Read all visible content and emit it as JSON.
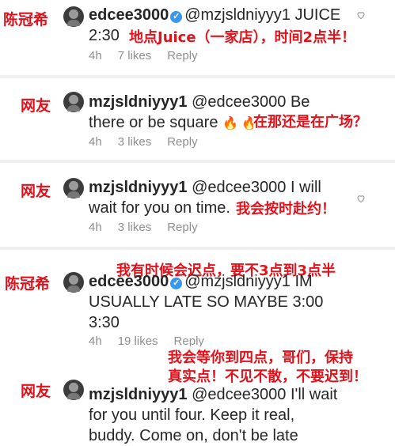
{
  "comments": [
    {
      "tag": "陈冠希",
      "username": "edcee3000",
      "verified": true,
      "mention": "@mzjsldniyyy1",
      "text_lines": [
        "JUICE",
        "2:30"
      ],
      "time": "4h",
      "likes": "7 likes",
      "reply": "Reply",
      "annotation": "地点Juice（一家店），时间2点半！"
    },
    {
      "tag": "网友",
      "username": "mzjsldniyyy1",
      "mention": "@edcee3000",
      "text_lines": [
        "Be",
        "there or be square"
      ],
      "emoji": "🔥 🔥",
      "time": "4h",
      "likes": "3 likes",
      "reply": "Reply",
      "annotation": "在那还是在广场？"
    },
    {
      "tag": "网友",
      "username": "mzjsldniyyy1",
      "mention": "@edcee3000",
      "text_lines": [
        "I will",
        "wait for you on time."
      ],
      "time": "4h",
      "likes": "3 likes",
      "reply": "Reply",
      "annotation": "我会按时赴约！"
    },
    {
      "tag": "陈冠希",
      "username": "edcee3000",
      "verified": true,
      "mention": "@mzjsldniyyy1",
      "text_lines": [
        "IM",
        "USUALLY LATE SO MAYBE 3:00",
        "3:30"
      ],
      "time": "4h",
      "likes": "19 likes",
      "reply": "Reply",
      "annotation": "我有时候会迟点，要不3点到3点半"
    },
    {
      "tag": "网友",
      "username": "mzjsldniyyy1",
      "mention": "@edcee3000",
      "text_lines": [
        "I'll wait",
        "for you until four. Keep it real,",
        "buddy. Come on, don't be late"
      ],
      "annotation_lines": [
        "我会等你到四点，哥们，保持",
        "真实点！不见不散，不要迟到！"
      ]
    }
  ],
  "colors": {
    "annotation": "#e0121b",
    "meta": "#8e8e8e",
    "verified": "#3897f0"
  }
}
